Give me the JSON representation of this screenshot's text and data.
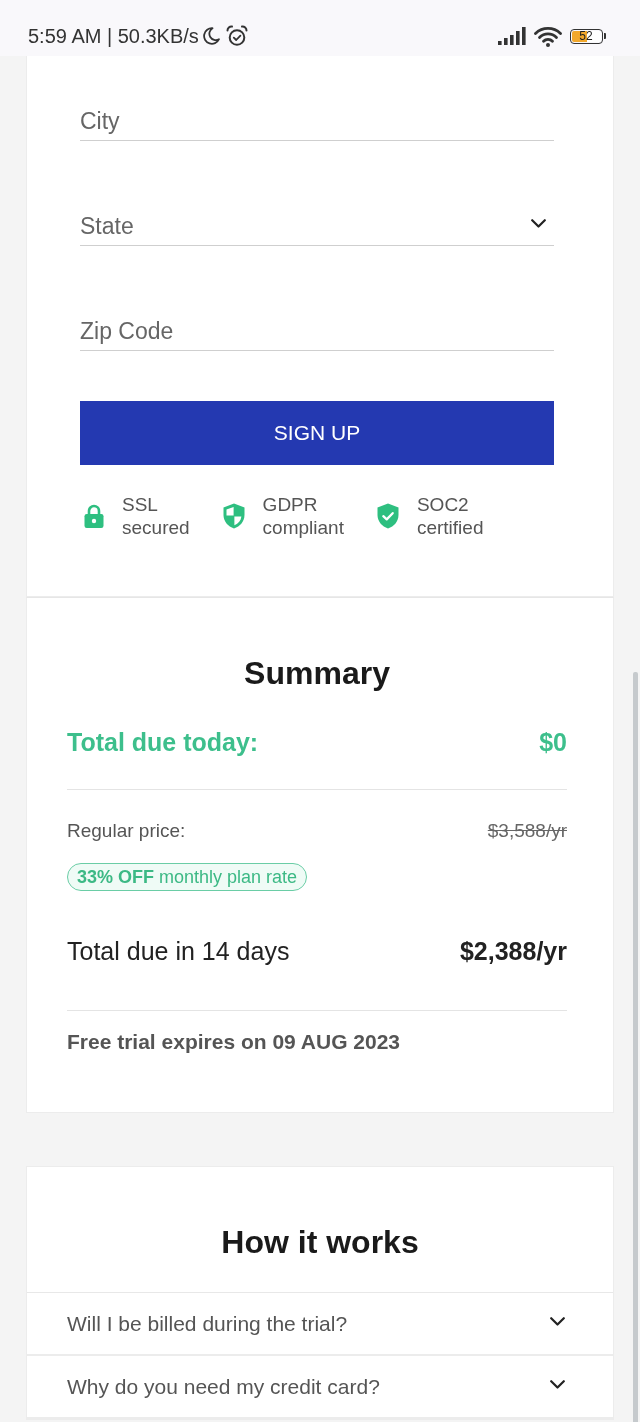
{
  "status_bar": {
    "time": "5:59 AM | 50.3KB/s",
    "battery": "52"
  },
  "form": {
    "fields": [
      {
        "kind": "text",
        "placeholder": "City"
      },
      {
        "kind": "select",
        "placeholder": "State"
      },
      {
        "kind": "text",
        "placeholder": "Zip Code"
      }
    ],
    "submit": "SIGN UP",
    "badges": [
      {
        "kind": "lock",
        "lines": [
          "SSL",
          "secured"
        ]
      },
      {
        "kind": "shield",
        "lines": [
          "GDPR",
          "compliant"
        ]
      },
      {
        "kind": "shield_check",
        "lines": [
          "SOC2",
          "certified"
        ]
      }
    ]
  },
  "summary": {
    "title": "Summary",
    "due_today": {
      "label": "Total due today:",
      "value": "$0"
    },
    "regular_price": {
      "label": "Regular price:",
      "value": "$3,588/yr"
    },
    "discount": "**33% OFF** monthly plan rate",
    "due_later": {
      "label": "Total due in 14 days",
      "value": "$2,388/yr"
    },
    "trial_note": "Free trial expires on 09 AUG 2023"
  },
  "how_it_works": {
    "title": "How it works",
    "faqs": [
      {
        "question": "Will I be billed during the trial?",
        "expanded": false
      },
      {
        "question": "Why do you need my credit card?",
        "expanded": false
      }
    ]
  }
}
